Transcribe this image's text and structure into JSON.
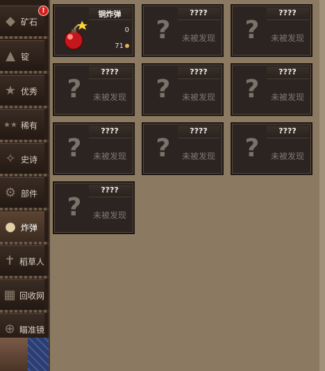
{
  "sidebar": {
    "badge": "!",
    "items": [
      {
        "label": "矿石",
        "icon": "ore-icon",
        "glyph": "◆"
      },
      {
        "label": "锭",
        "icon": "ingot-icon",
        "glyph": "▲"
      },
      {
        "label": "优秀",
        "icon": "star-icon",
        "glyph": "★"
      },
      {
        "label": "稀有",
        "icon": "double-star-icon",
        "glyph": "★★"
      },
      {
        "label": "史诗",
        "icon": "epic-icon",
        "glyph": "✧"
      },
      {
        "label": "部件",
        "icon": "gear-icon",
        "glyph": "⚙"
      },
      {
        "label": "炸弹",
        "icon": "bomb-icon",
        "glyph": "●",
        "active": true
      },
      {
        "label": "稻草人",
        "icon": "scarecrow-icon",
        "glyph": "✝"
      },
      {
        "label": "回收网",
        "icon": "net-icon",
        "glyph": "▦"
      },
      {
        "label": "瞄准镜",
        "icon": "crosshair-icon",
        "glyph": "⊕"
      }
    ]
  },
  "cards": [
    {
      "name": "铜炸弹",
      "discovered": true,
      "value1": "0",
      "value2": "71"
    },
    {
      "name": "????",
      "status": "未被发现"
    },
    {
      "name": "????",
      "status": "未被发现"
    },
    {
      "name": "????",
      "status": "未被发现"
    },
    {
      "name": "????",
      "status": "未被发现"
    },
    {
      "name": "????",
      "status": "未被发现"
    },
    {
      "name": "????",
      "status": "未被发现"
    },
    {
      "name": "????",
      "status": "未被发现"
    },
    {
      "name": "????",
      "status": "未被发现"
    },
    {
      "name": "????",
      "status": "未被发现"
    }
  ],
  "unknown_glyph": "?"
}
